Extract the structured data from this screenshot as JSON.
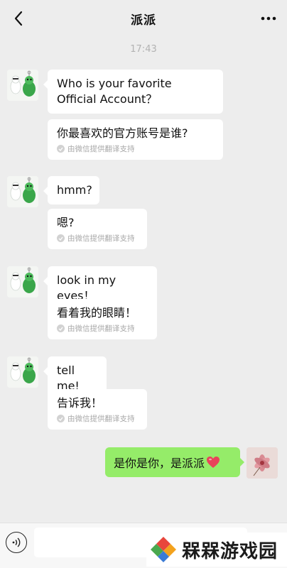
{
  "header": {
    "title": "派派",
    "back_icon": "chevron-left-icon",
    "more_icon": "more-dots-icon"
  },
  "timestamp": "17:43",
  "translation_note": "由微信提供翻译支持",
  "messages": [
    {
      "text": "Who is your favorite Official Account？",
      "translation": "你最喜欢的官方账号是谁?"
    },
    {
      "text": "hmm?",
      "translation": "嗯?"
    },
    {
      "text": "look in my eyes！",
      "translation": "看着我的眼睛！"
    },
    {
      "text": "tell me!",
      "translation": "告诉我！"
    }
  ],
  "my_message": {
    "text": "是你是你，是派派"
  },
  "input": {
    "placeholder": "",
    "voice_icon": "voice-icon"
  },
  "watermark": {
    "text": "槑槑游戏园"
  },
  "colors": {
    "background": "#ededed",
    "my_bubble": "#95ec69",
    "their_bubble": "#ffffff",
    "heart": "#e8445a"
  }
}
